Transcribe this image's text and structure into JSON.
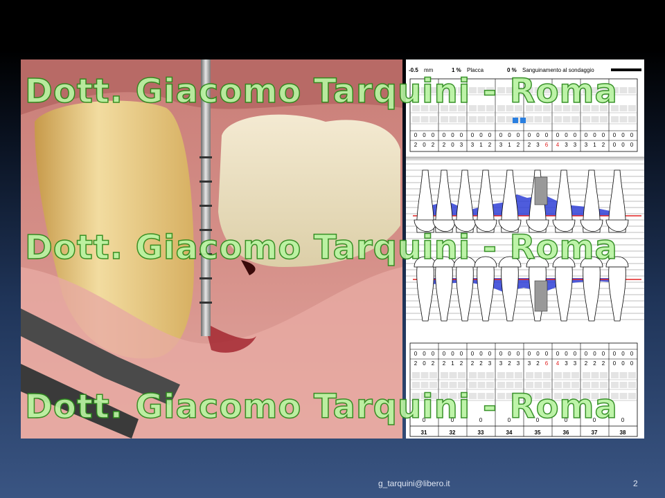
{
  "slide": {
    "footer_email": "g_tarquini@libero.it",
    "page_number": "2"
  },
  "watermark": {
    "text": "Dott. Giacomo Tarquini - Roma"
  },
  "chart": {
    "mean_depth": "-0.5",
    "mean_depth_unit": "mm",
    "plaque_value": "1 %",
    "plaque_label": "Placca",
    "bleeding_value": "0 %",
    "bleeding_label": "Sanguinamento al sondaggio",
    "upper_row1": [
      "0",
      "0",
      "0",
      "0",
      "0",
      "0",
      "0",
      "0",
      "0",
      "0",
      "0",
      "0",
      "0",
      "0",
      "0",
      "0",
      "0",
      "0",
      "0",
      "0",
      "0",
      "0",
      "0",
      "0"
    ],
    "upper_row2": [
      "2",
      "0",
      "2",
      "2",
      "0",
      "3",
      "3",
      "1",
      "2",
      "3",
      "1",
      "2",
      "2",
      "3",
      "6",
      "4",
      "3",
      "3",
      "3",
      "1",
      "2",
      "0",
      "0",
      "0"
    ],
    "lower_row1": [
      "0",
      "0",
      "0",
      "0",
      "0",
      "0",
      "0",
      "0",
      "0",
      "0",
      "0",
      "0",
      "0",
      "0",
      "0",
      "0",
      "0",
      "0",
      "0",
      "0",
      "0",
      "0",
      "0",
      "0"
    ],
    "lower_row2": [
      "2",
      "0",
      "2",
      "2",
      "1",
      "2",
      "2",
      "2",
      "3",
      "3",
      "2",
      "3",
      "3",
      "2",
      "6",
      "4",
      "3",
      "3",
      "2",
      "2",
      "2",
      "0",
      "0",
      "0"
    ],
    "bottom_values": [
      "0",
      "0",
      "0",
      "0",
      "0",
      "0",
      "0",
      "0"
    ],
    "tooth_numbers": [
      "31",
      "32",
      "33",
      "34",
      "35",
      "36",
      "37",
      "38"
    ]
  },
  "colors": {
    "accent": "#1f3a8a",
    "probing_fill": "#2f3fd6",
    "gingival_line": "#e02020",
    "watermark_fill": "#b9f4a2"
  }
}
